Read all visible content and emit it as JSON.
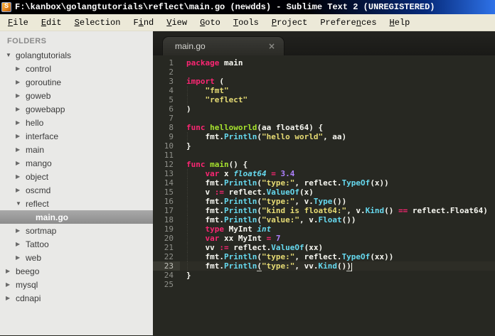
{
  "window": {
    "title": "F:\\kanbox\\golangtutorials\\reflect\\main.go (newdds) - Sublime Text 2 (UNREGISTERED)",
    "app_icon_letter": "S"
  },
  "menu": {
    "items": [
      {
        "label": "File",
        "u": 0
      },
      {
        "label": "Edit",
        "u": 0
      },
      {
        "label": "Selection",
        "u": 0
      },
      {
        "label": "Find",
        "u": 1
      },
      {
        "label": "View",
        "u": 0
      },
      {
        "label": "Goto",
        "u": 0
      },
      {
        "label": "Tools",
        "u": 0
      },
      {
        "label": "Project",
        "u": 0
      },
      {
        "label": "Preferences",
        "u": 7
      },
      {
        "label": "Help",
        "u": 0
      }
    ]
  },
  "sidebar": {
    "header": "FOLDERS",
    "items": [
      {
        "label": "golangtutorials",
        "level": 0,
        "arrow": "down"
      },
      {
        "label": "control",
        "level": 1,
        "arrow": "right"
      },
      {
        "label": "goroutine",
        "level": 1,
        "arrow": "right"
      },
      {
        "label": "goweb",
        "level": 1,
        "arrow": "right"
      },
      {
        "label": "gowebapp",
        "level": 1,
        "arrow": "right"
      },
      {
        "label": "hello",
        "level": 1,
        "arrow": "right"
      },
      {
        "label": "interface",
        "level": 1,
        "arrow": "right"
      },
      {
        "label": "main",
        "level": 1,
        "arrow": "right"
      },
      {
        "label": "mango",
        "level": 1,
        "arrow": "right"
      },
      {
        "label": "object",
        "level": 1,
        "arrow": "right"
      },
      {
        "label": "oscmd",
        "level": 1,
        "arrow": "right"
      },
      {
        "label": "reflect",
        "level": 1,
        "arrow": "down"
      },
      {
        "label": "main.go",
        "level": 2,
        "arrow": "none",
        "selected": true
      },
      {
        "label": "sortmap",
        "level": 1,
        "arrow": "right"
      },
      {
        "label": "Tattoo",
        "level": 1,
        "arrow": "right"
      },
      {
        "label": "web",
        "level": 1,
        "arrow": "right"
      },
      {
        "label": "beego",
        "level": 0,
        "arrow": "right"
      },
      {
        "label": "mysql",
        "level": 0,
        "arrow": "right"
      },
      {
        "label": "cdnapi",
        "level": 0,
        "arrow": "right"
      }
    ]
  },
  "tabs": [
    {
      "label": "main.go",
      "close": "×",
      "active": true
    }
  ],
  "editor": {
    "current_line": 23,
    "lines": [
      {
        "n": 1,
        "t": [
          [
            "p",
            "package"
          ],
          [
            "w",
            " main"
          ]
        ]
      },
      {
        "n": 2,
        "t": []
      },
      {
        "n": 3,
        "t": [
          [
            "p",
            "import"
          ],
          [
            "w",
            " ("
          ]
        ]
      },
      {
        "n": 4,
        "t": [
          [
            "w",
            "    "
          ],
          [
            "y",
            "\"fmt\""
          ]
        ]
      },
      {
        "n": 5,
        "t": [
          [
            "w",
            "    "
          ],
          [
            "y",
            "\"reflect\""
          ]
        ]
      },
      {
        "n": 6,
        "t": [
          [
            "w",
            ")"
          ]
        ]
      },
      {
        "n": 7,
        "t": []
      },
      {
        "n": 8,
        "t": [
          [
            "p",
            "func"
          ],
          [
            "w",
            " "
          ],
          [
            "g",
            "helloworld"
          ],
          [
            "w",
            "(aa float64) {"
          ]
        ]
      },
      {
        "n": 9,
        "t": [
          [
            "w",
            "    fmt."
          ],
          [
            "c",
            "Println"
          ],
          [
            "w",
            "("
          ],
          [
            "y",
            "\"hello world\""
          ],
          [
            "w",
            ", aa)"
          ]
        ]
      },
      {
        "n": 10,
        "t": [
          [
            "w",
            "}"
          ]
        ]
      },
      {
        "n": 11,
        "t": []
      },
      {
        "n": 12,
        "t": [
          [
            "p",
            "func"
          ],
          [
            "w",
            " "
          ],
          [
            "g",
            "main"
          ],
          [
            "w",
            "() {"
          ]
        ]
      },
      {
        "n": 13,
        "t": [
          [
            "w",
            "    "
          ],
          [
            "p",
            "var"
          ],
          [
            "w",
            " x "
          ],
          [
            "ci",
            "float64"
          ],
          [
            "w",
            " "
          ],
          [
            "p",
            "="
          ],
          [
            "w",
            " "
          ],
          [
            "u",
            "3.4"
          ]
        ]
      },
      {
        "n": 14,
        "t": [
          [
            "w",
            "    fmt."
          ],
          [
            "c",
            "Println"
          ],
          [
            "w",
            "("
          ],
          [
            "y",
            "\"type:\""
          ],
          [
            "w",
            ", reflect."
          ],
          [
            "c",
            "TypeOf"
          ],
          [
            "w",
            "(x))"
          ]
        ]
      },
      {
        "n": 15,
        "t": [
          [
            "w",
            "    v "
          ],
          [
            "p",
            ":="
          ],
          [
            "w",
            " reflect."
          ],
          [
            "c",
            "ValueOf"
          ],
          [
            "w",
            "(x)"
          ]
        ]
      },
      {
        "n": 16,
        "t": [
          [
            "w",
            "    fmt."
          ],
          [
            "c",
            "Println"
          ],
          [
            "w",
            "("
          ],
          [
            "y",
            "\"type:\""
          ],
          [
            "w",
            ", v."
          ],
          [
            "c",
            "Type"
          ],
          [
            "w",
            "())"
          ]
        ]
      },
      {
        "n": 17,
        "t": [
          [
            "w",
            "    fmt."
          ],
          [
            "c",
            "Println"
          ],
          [
            "w",
            "("
          ],
          [
            "y",
            "\"kind is float64:\""
          ],
          [
            "w",
            ", v."
          ],
          [
            "c",
            "Kind"
          ],
          [
            "w",
            "() "
          ],
          [
            "p",
            "=="
          ],
          [
            "w",
            " reflect.Float64)"
          ]
        ]
      },
      {
        "n": 18,
        "t": [
          [
            "w",
            "    fmt."
          ],
          [
            "c",
            "Println"
          ],
          [
            "w",
            "("
          ],
          [
            "y",
            "\"value:\""
          ],
          [
            "w",
            ", v."
          ],
          [
            "c",
            "Float"
          ],
          [
            "w",
            "())"
          ]
        ]
      },
      {
        "n": 19,
        "t": [
          [
            "w",
            "    "
          ],
          [
            "p",
            "type"
          ],
          [
            "w",
            " MyInt "
          ],
          [
            "ci",
            "int"
          ]
        ]
      },
      {
        "n": 20,
        "t": [
          [
            "w",
            "    "
          ],
          [
            "p",
            "var"
          ],
          [
            "w",
            " xx MyInt "
          ],
          [
            "p",
            "="
          ],
          [
            "w",
            " "
          ],
          [
            "u",
            "7"
          ]
        ]
      },
      {
        "n": 21,
        "t": [
          [
            "w",
            "    vv "
          ],
          [
            "p",
            ":="
          ],
          [
            "w",
            " reflect."
          ],
          [
            "c",
            "ValueOf"
          ],
          [
            "w",
            "(xx)"
          ]
        ]
      },
      {
        "n": 22,
        "t": [
          [
            "w",
            "    fmt."
          ],
          [
            "c",
            "Println"
          ],
          [
            "w",
            "("
          ],
          [
            "y",
            "\"type:\""
          ],
          [
            "w",
            ", reflect."
          ],
          [
            "c",
            "TypeOf"
          ],
          [
            "w",
            "(xx))"
          ]
        ]
      },
      {
        "n": 23,
        "t": [
          [
            "w",
            "    fmt."
          ],
          [
            "c",
            "Println"
          ],
          [
            "w",
            "(",
            1
          ],
          [
            "y",
            "\"type:\""
          ],
          [
            "w",
            ", vv."
          ],
          [
            "c",
            "Kind"
          ],
          [
            "w",
            "()"
          ],
          [
            "w",
            ")",
            1
          ]
        ]
      },
      {
        "n": 24,
        "t": [
          [
            "w",
            "}"
          ]
        ]
      },
      {
        "n": 25,
        "t": []
      }
    ]
  },
  "colors": {
    "editor_bg": "#272822",
    "keyword_pink": "#f92672",
    "function_green": "#a6e22e",
    "string_yellow": "#e6db74",
    "support_cyan": "#66d9ef",
    "number_purple": "#ae81ff",
    "foreground": "#f8f8f2",
    "gutter_gray": "#8f908a",
    "sidebar_bg": "#e9e9e7",
    "menubar_bg": "#ece9d8",
    "titlebar_blue": "#2e72e8"
  }
}
